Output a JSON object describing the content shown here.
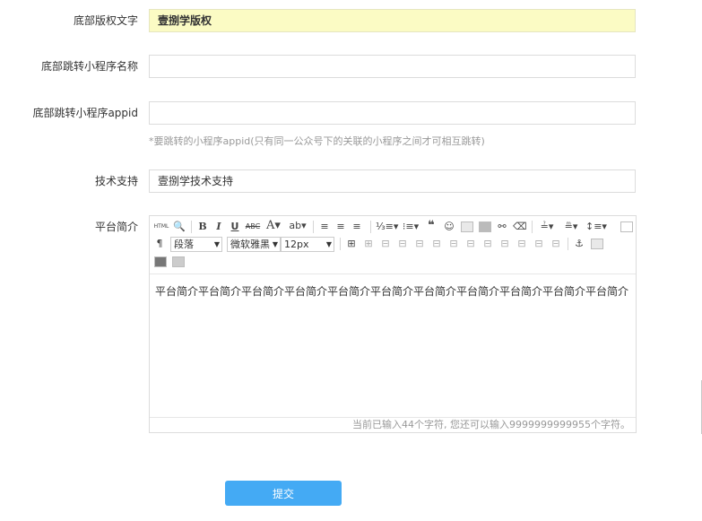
{
  "form": {
    "footer_copyright": {
      "label": "底部版权文字",
      "value": "壹捌学版权"
    },
    "footer_miniapp_name": {
      "label": "底部跳转小程序名称",
      "value": ""
    },
    "footer_miniapp_appid": {
      "label": "底部跳转小程序appid",
      "value": "",
      "hint": "*要跳转的小程序appid(只有同一公众号下的关联的小程序之间才可相互跳转)"
    },
    "tech_support": {
      "label": "技术支持",
      "value": "壹捌学技术支持"
    },
    "intro": {
      "label": "平台简介",
      "toolbar": {
        "paragraph": "段落",
        "font_family": "微软雅黑",
        "font_size": "12px"
      },
      "content": "平台简介平台简介平台简介平台简介平台简介平台简介平台简介平台简介平台简介平台简介平台简介",
      "counter": "当前已输入44个字符, 您还可以输入9999999999955个字符。"
    },
    "submit_label": "提交"
  }
}
